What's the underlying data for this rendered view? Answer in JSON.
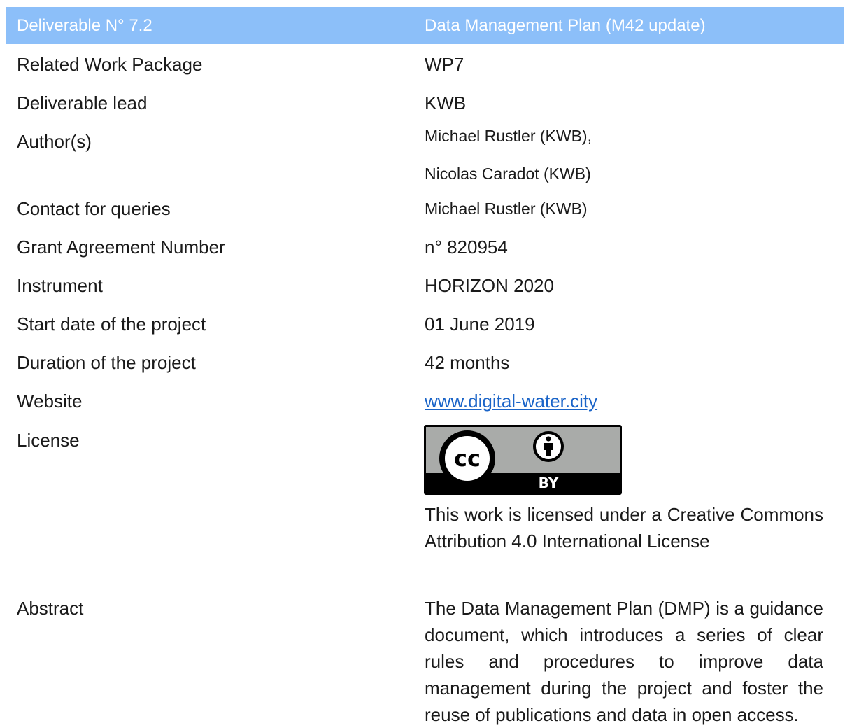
{
  "header": {
    "left": "Deliverable N° 7.2",
    "right": "Data Management Plan (M42 update)"
  },
  "rows": {
    "work_package": {
      "label": "Related Work Package",
      "value": "WP7"
    },
    "lead": {
      "label": "Deliverable lead",
      "value": "KWB"
    },
    "authors": {
      "label": "Author(s)",
      "value1": "Michael Rustler (KWB),",
      "value2": "Nicolas Caradot (KWB)"
    },
    "contact": {
      "label": "Contact for queries",
      "value": "Michael Rustler (KWB)"
    },
    "grant": {
      "label": "Grant Agreement Number",
      "value": "n° 820954"
    },
    "instrument": {
      "label": "Instrument",
      "value": "HORIZON 2020"
    },
    "start_date": {
      "label": "Start date of the project",
      "value": "01 June 2019"
    },
    "duration": {
      "label": "Duration of the project",
      "value": "42 months"
    },
    "website": {
      "label": "Website",
      "value": "www.digital-water.city"
    },
    "license": {
      "label": "License",
      "badge_cc": "cc",
      "badge_by": "BY",
      "text": "This work is licensed under a Creative Commons Attribution 4.0 International License"
    },
    "abstract": {
      "label": "Abstract",
      "text": "The Data Management Plan (DMP) is a guidance document, which introduces a series of clear rules and procedures to improve data management during the project and foster the reuse of publications and data in open access."
    }
  },
  "colors": {
    "header_bg": "#8cbff9",
    "header_text": "#ffffff",
    "link": "#1a64c8",
    "badge_gray": "#a9aba9"
  }
}
